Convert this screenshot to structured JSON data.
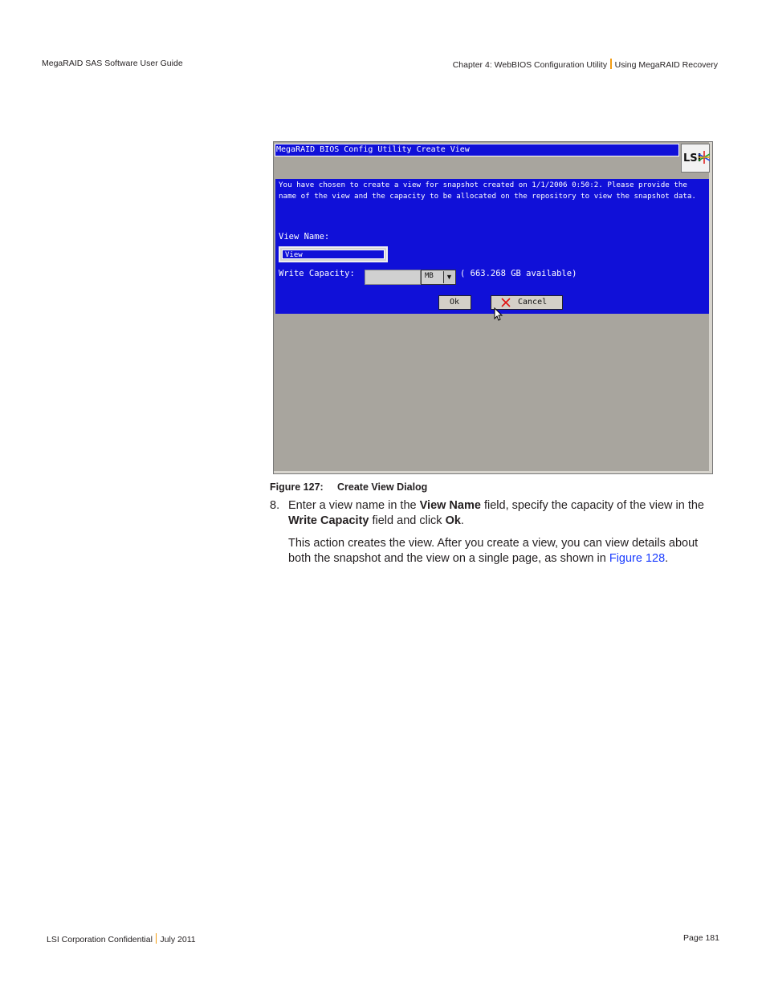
{
  "header": {
    "left": "MegaRAID SAS Software User Guide",
    "right_chapter": "Chapter 4: WebBIOS Configuration Utility",
    "right_section": "Using MegaRAID Recovery"
  },
  "screenshot": {
    "title": "MegaRAID BIOS Config Utility Create View",
    "logo_text": "LSI",
    "message_line1": "You have chosen to create a view for snapshot created on  1/1/2006 0:50:2. Please provide the",
    "message_line2": "name of the view and the capacity to be allocated on the repository to view the snapshot data.",
    "view_name_label": "View Name:",
    "view_name_value": "View",
    "write_capacity_label": "Write Capacity:",
    "write_capacity_value": "",
    "unit_value": "MB",
    "available_text": "( 663.268 GB available)",
    "ok_label": "Ok",
    "cancel_label": "Cancel",
    "colors": {
      "dialog_blue": "#1010d8",
      "background_gray": "#a8a59e"
    }
  },
  "figure": {
    "number": "Figure 127:",
    "title": "Create View Dialog"
  },
  "step8": {
    "number": "8.",
    "t1": "Enter a view name in the ",
    "b1": "View Name",
    "t2": " field, specify the capacity of the view in the ",
    "b2": "Write Capacity",
    "t3": " field and click ",
    "b3": "Ok",
    "t4": "."
  },
  "para": {
    "text": "This action creates the view. After you create a view, you can view details about both the snapshot and the view on a single page, as shown in ",
    "link": "Figure 128",
    "end": "."
  },
  "footer": {
    "left": "LSI Corporation Confidential",
    "date": "July 2011",
    "page": "Page 181"
  }
}
